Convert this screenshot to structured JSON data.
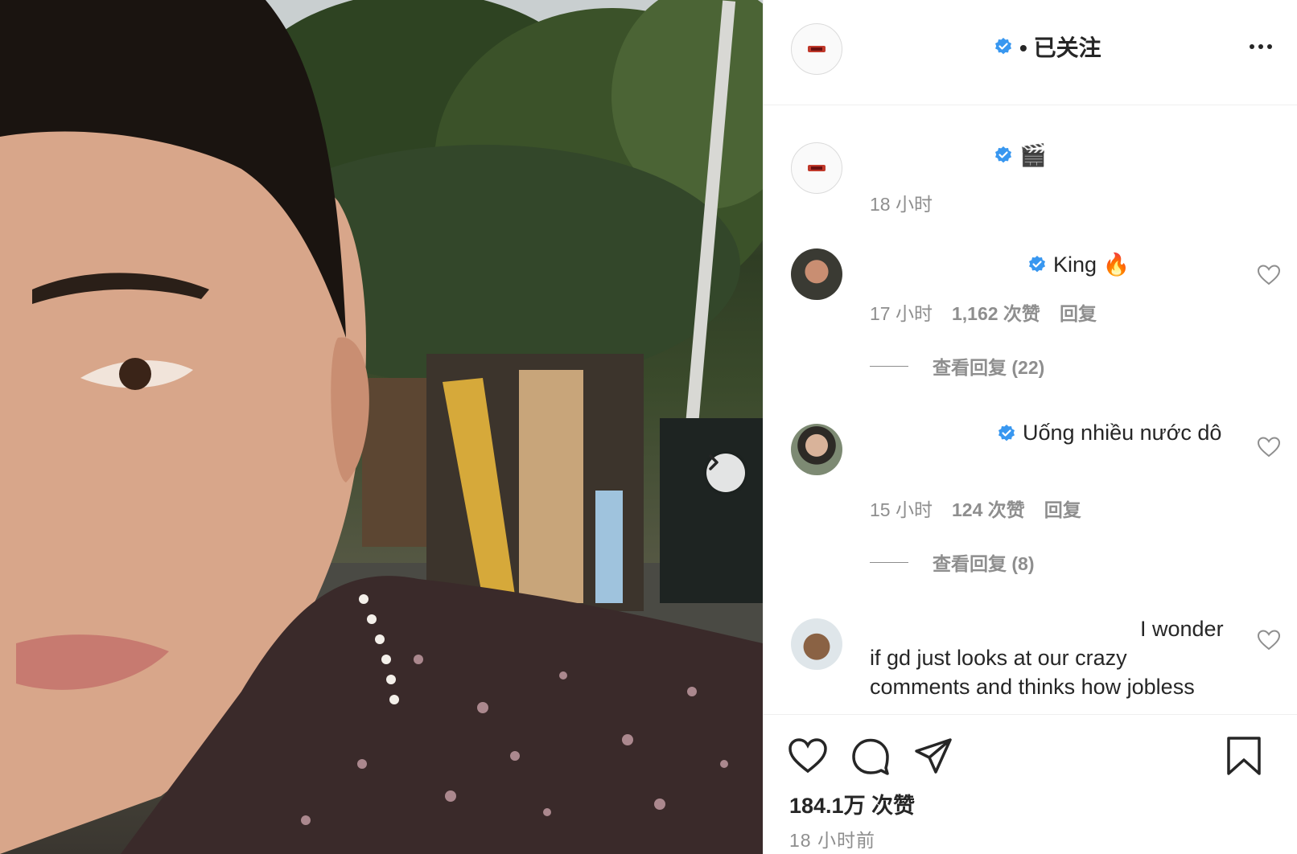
{
  "header": {
    "follow_status": "• 已关注"
  },
  "caption": {
    "emoji": "🎬",
    "time": "18 小时"
  },
  "comments": [
    {
      "text": "King 🔥",
      "time": "17 小时",
      "likes": "1,162 次赞",
      "reply_label": "回复",
      "view_replies": "查看回复 (22)"
    },
    {
      "text": "Uống nhiều nước dô",
      "time": "15 小时",
      "likes": "124 次赞",
      "reply_label": "回复",
      "view_replies": "查看回复 (8)"
    },
    {
      "text_line1": "I wonder",
      "text_line2": "if gd just looks at our crazy",
      "text_line3": "comments and thinks how jobless"
    }
  ],
  "footer": {
    "likes": "184.1万 次赞",
    "time": "18 小时前"
  },
  "icons": {
    "verified": "verified-badge-icon",
    "heart": "heart-icon",
    "comment": "comment-icon",
    "share": "paper-plane-icon",
    "save": "bookmark-icon",
    "more": "ellipsis-icon",
    "next": "chevron-right-icon"
  },
  "colors": {
    "verified_blue": "#3897f0",
    "meta_gray": "#8e8e8e",
    "text": "#262626"
  }
}
